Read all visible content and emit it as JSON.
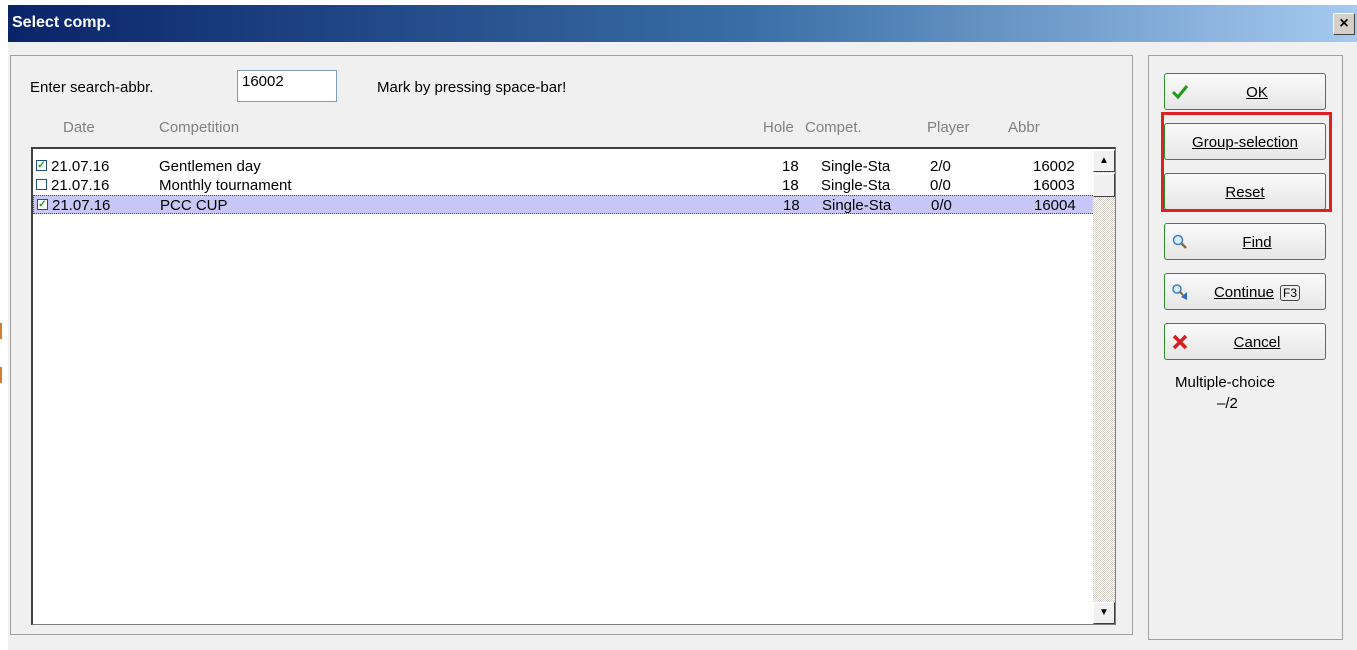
{
  "window": {
    "title": "Select comp.",
    "close_symbol": "×"
  },
  "search": {
    "label": "Enter search-abbr.",
    "value": "16002",
    "hint": "Mark by pressing space-bar!"
  },
  "columns": {
    "date": "Date",
    "competition": "Competition",
    "hole": "Hole",
    "compet": "Compet.",
    "player": "Player",
    "abbr": "Abbr"
  },
  "rows": [
    {
      "checked": true,
      "date": "21.07.16",
      "competition": "Gentlemen day",
      "hole": "18",
      "compet": "Single-Sta",
      "player": "2/0",
      "abbr": "16002",
      "selected": false
    },
    {
      "checked": false,
      "date": "21.07.16",
      "competition": "Monthly tournament",
      "hole": "18",
      "compet": "Single-Sta",
      "player": "0/0",
      "abbr": "16003",
      "selected": false
    },
    {
      "checked": true,
      "date": "21.07.16",
      "competition": "PCC CUP",
      "hole": "18",
      "compet": "Single-Sta",
      "player": "0/0",
      "abbr": "16004",
      "selected": true
    }
  ],
  "buttons": {
    "ok": "OK",
    "group_selection": "Group-selection",
    "reset": "Reset",
    "find": "Find",
    "continue": "Continue",
    "continue_shortcut": "F3",
    "cancel": "Cancel"
  },
  "multiple_choice": {
    "label": "Multiple-choice",
    "count": "–/2"
  },
  "icons": {
    "ok": "checkmark-icon",
    "find": "magnifier-icon",
    "continue": "magnifier-arrow-icon",
    "cancel": "red-x-icon"
  },
  "colors": {
    "title_start": "#0a246a",
    "title_end": "#a6caf0",
    "selected_row": "#c8c8f8",
    "button_border": "#2e8b2e",
    "highlight": "#e02020"
  }
}
